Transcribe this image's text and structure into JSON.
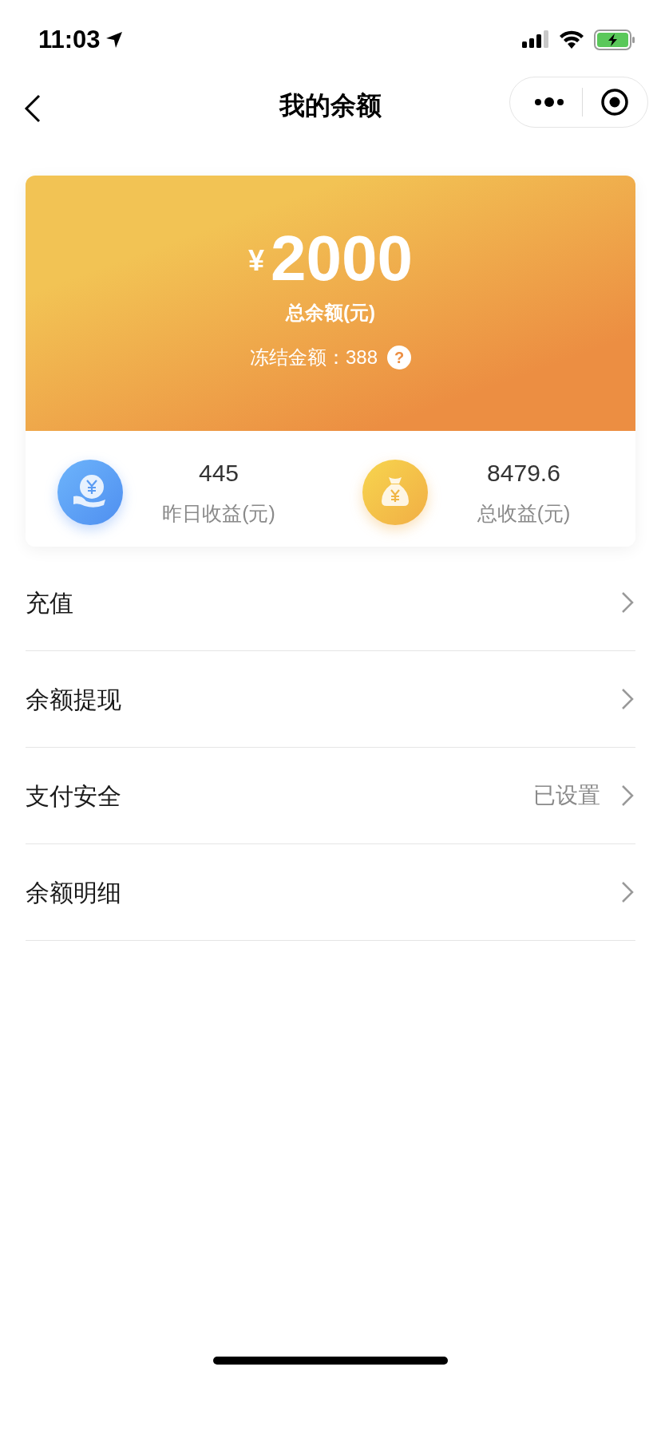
{
  "status_bar": {
    "time": "11:03"
  },
  "nav": {
    "title": "我的余额"
  },
  "balance": {
    "currency": "¥",
    "amount": "2000",
    "label": "总余额(元)",
    "frozen": "冻结金额：388",
    "help": "?"
  },
  "stats": [
    {
      "kind": "hand-coin",
      "value": "445",
      "label": "昨日收益(元)"
    },
    {
      "kind": "money-bag",
      "value": "8479.6",
      "label": "总收益(元)"
    }
  ],
  "menu": [
    {
      "label": "充值"
    },
    {
      "label": "余额提现"
    },
    {
      "label": "支付安全",
      "value": "已设置"
    },
    {
      "label": "余额明细"
    }
  ]
}
